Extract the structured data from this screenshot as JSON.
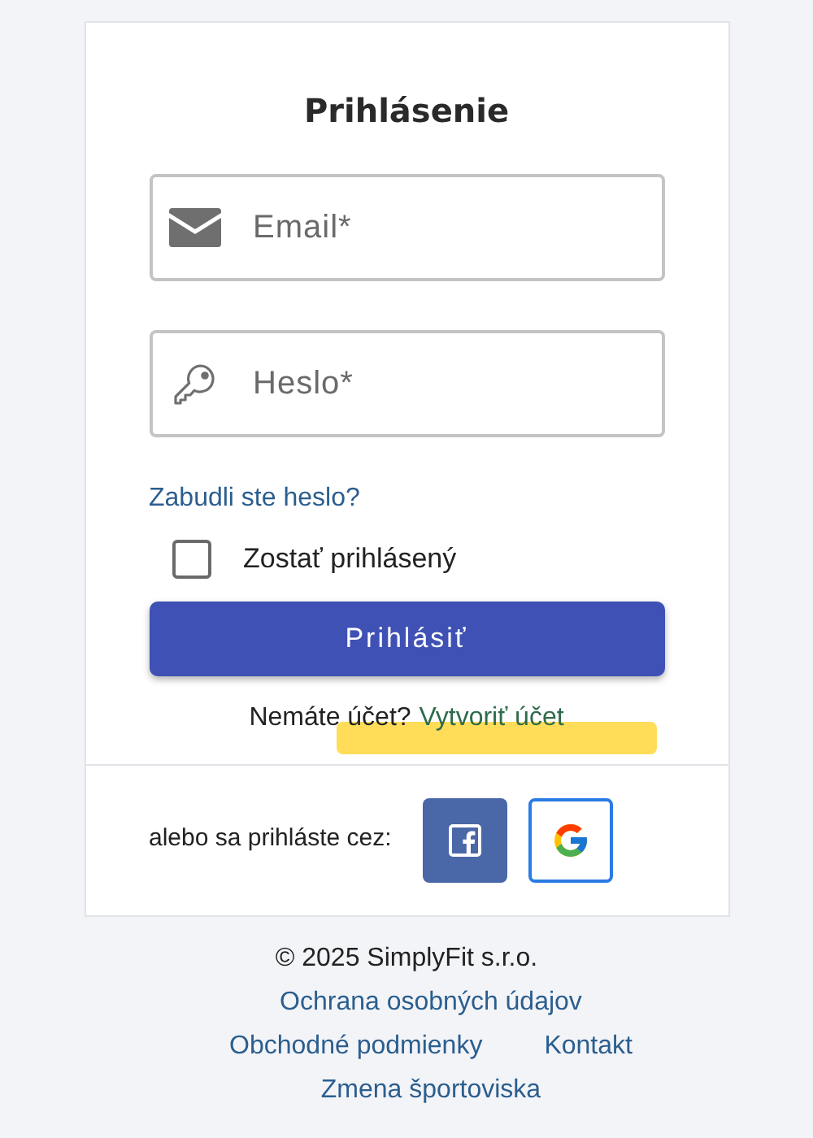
{
  "title": "Prihlásenie",
  "fields": [
    {
      "kind": "email",
      "placeholder": "Email*"
    },
    {
      "kind": "password",
      "placeholder": "Heslo*"
    }
  ],
  "forgot_link": "Zabudli ste heslo?",
  "remember": {
    "label": "Zostať prihlásený",
    "checked": false
  },
  "submit_button": "Prihlásiť",
  "signup": {
    "text": "Nemáte účet?",
    "link": "Vytvoriť účet",
    "highlighted": true
  },
  "social": {
    "label": "alebo sa prihláste cez:",
    "buttons": [
      {
        "kind": "facebook"
      },
      {
        "kind": "google"
      }
    ]
  },
  "footer": {
    "copyright": "© 2025 SimplyFit s.r.o.",
    "links": [
      [
        "Ochrana osobných údajov"
      ],
      [
        "Obchodné podmienky",
        "Kontakt"
      ],
      [
        "Zmena športoviska"
      ]
    ]
  }
}
